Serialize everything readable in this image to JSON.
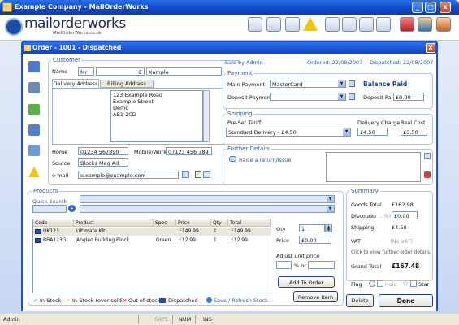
{
  "window": {
    "title": "Example Company - MailOrderWorks"
  },
  "logo": {
    "text": "mailorderworks",
    "subtitle": "MailOrderWorks.co.uk"
  },
  "dialog": {
    "title": "Order - 1001 - Dispatched",
    "close": "X"
  },
  "customer": {
    "section": "Customer",
    "name_label": "Name",
    "title": "Mr",
    "initial": "E",
    "surname": "Xample",
    "tabs": [
      "Delivery Address",
      "Billing Address"
    ],
    "address_lines": [
      "123 Example Road",
      "Example Street",
      "Demo",
      "AB1 2CD"
    ],
    "home_label": "Home",
    "home": "01234 567890",
    "mobile_label": "Mobile/Work",
    "mobile": "07123 456 789",
    "source_label": "Source",
    "source": "Blocks Mag Ad",
    "email_label": "e-mail",
    "email": "e.xample@example.com"
  },
  "order_info": {
    "sale_by": "Sale by Admin",
    "ordered": "Ordered: 22/08/2007",
    "dispatched": "Dispatched: 22/08/2007"
  },
  "payment": {
    "section": "Payment",
    "main_label": "Main Payment",
    "main_value": "MasterCard",
    "status": "Balance Paid",
    "deposit_label": "Deposit Payment",
    "deposit_value": "",
    "deposit_paid_label": "Deposit Paid",
    "deposit_paid": "£0.00"
  },
  "shipping": {
    "section": "Shipping",
    "tariff_label": "Pre-Set Tariff",
    "tariff_value": "Standard Delivery - £4.50",
    "charge_label": "Delivery Charge",
    "charge": "£4.50",
    "real_label": "Real Cost",
    "real": "£3.50"
  },
  "further": {
    "section": "Further Details",
    "return_link": "Raise a return/issue"
  },
  "products": {
    "section": "Products",
    "quick_search_label": "Quick Search",
    "columns": [
      "Code",
      "Product",
      "Spec",
      "Price",
      "Qty",
      "Total"
    ],
    "rows": [
      {
        "code": "UK123",
        "product": "Ultimate Kit",
        "spec": "",
        "price": "£149.99",
        "qty": "1",
        "total": "£149.99"
      },
      {
        "code": "BBA123G",
        "product": "Angled Building Block",
        "spec": "Green",
        "price": "£12.99",
        "qty": "1",
        "total": "£12.99"
      }
    ],
    "qty_label": "Qty",
    "qty": "1",
    "price_label": "Price",
    "price": "£0.00",
    "adjust_label": "Adjust unit price",
    "percent_or": "% or",
    "add_button": "Add To Order",
    "remove_button": "Remove Item",
    "legend": [
      "In-Stock",
      "In-Stock (over sold)",
      "Out of stock",
      "Dispatched"
    ],
    "save_link": "Save / Refresh Stock."
  },
  "summary": {
    "section": "Summary",
    "goods_label": "Goods Total",
    "goods": "£162.98",
    "discount_label": "Discount",
    "discount_hint": "(or ...%)",
    "discount": "£0.00",
    "shipping_label": "Shipping",
    "shipping": "£4.50",
    "vat_label": "VAT",
    "vat": "(No VAT)",
    "note": "Click to view further order details.",
    "grand_label": "Grand Total",
    "grand": "£167.48",
    "flag_label": "Flag",
    "hold": "Hold",
    "star": "Star"
  },
  "buttons": {
    "delete": "Delete",
    "done": "Done"
  },
  "statusbar": {
    "user": "Admin",
    "caps": "CAPS",
    "num": "NUM",
    "ins": "INS"
  }
}
